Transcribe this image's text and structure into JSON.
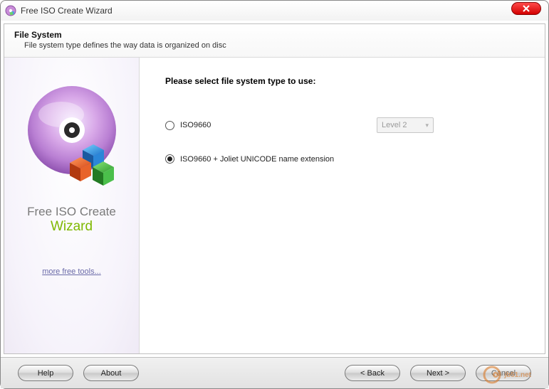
{
  "window": {
    "title": "Free ISO Create Wizard"
  },
  "header": {
    "title": "File System",
    "subtitle": "File system type defines the way data is organized on disc"
  },
  "sidebar": {
    "brand_line1": "Free ISO Create",
    "brand_line2": "Wizard",
    "more_link": "more free tools..."
  },
  "main": {
    "prompt": "Please select file system type to use:",
    "options": [
      {
        "label": "ISO9660",
        "selected": false
      },
      {
        "label": "ISO9660 + Joliet UNICODE name extension",
        "selected": true
      }
    ],
    "level_combo": {
      "value": "Level 2",
      "enabled": false
    }
  },
  "footer": {
    "help": "Help",
    "about": "About",
    "back": "< Back",
    "next": "Next >",
    "cancel": "Cancel"
  },
  "watermark": {
    "text": "jb51.net"
  }
}
